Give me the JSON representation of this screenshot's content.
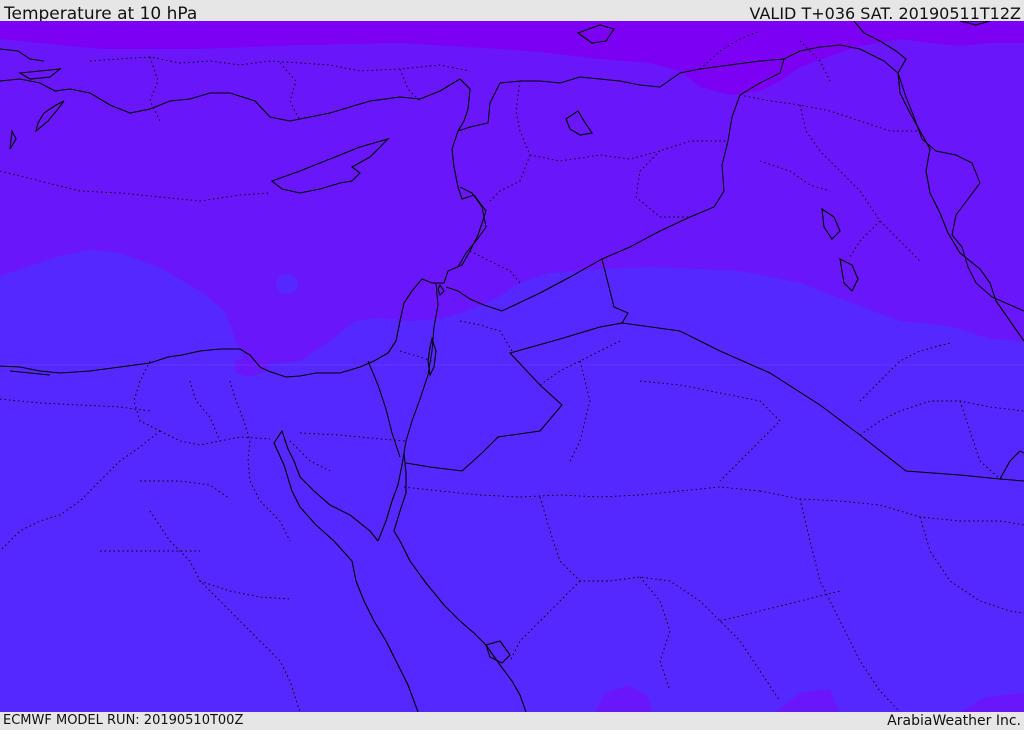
{
  "header": {
    "title": "Temperature at 10 hPa",
    "valid_time": "VALID T+036 SAT. 20190511T12Z"
  },
  "footer": {
    "model_run": "ECMWF MODEL RUN: 20190510T00Z",
    "credit": "ArabiaWeather Inc."
  },
  "map": {
    "field_colors": {
      "coldest": "#7c00f4",
      "cold": "#6a16fa",
      "mild": "#5528ff"
    },
    "boundary_color": "#000000"
  }
}
